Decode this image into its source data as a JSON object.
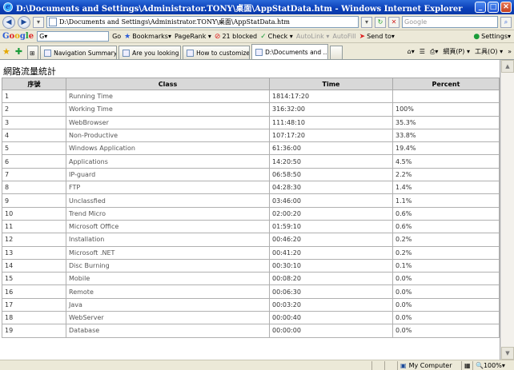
{
  "window": {
    "title": "D:\\Documents and Settings\\Administrator.TONY\\桌面\\AppStatData.htm - Windows Internet Explorer"
  },
  "addressbar": {
    "url": "D:\\Documents and Settings\\Administrator.TONY\\桌面\\AppStatData.htm",
    "search_placeholder": "Google"
  },
  "google_toolbar": {
    "logo": "Google",
    "search_value": "G▾",
    "go_label": "Go",
    "bookmarks_label": "Bookmarks▾",
    "pagerank_label": "PageRank ▾",
    "blocked_label": "21 blocked",
    "check_label": "Check ▾",
    "autolink_label": "AutoLink ▾",
    "autofill_label": "AutoFill",
    "sendto_label": "Send to▾",
    "settings_label": "Settings▾"
  },
  "tabs": [
    {
      "label": "Navigation Summary: ..."
    },
    {
      "label": "Are you looking for a ..."
    },
    {
      "label": "How to customize the ..."
    },
    {
      "label": "D:\\Documents and ..."
    }
  ],
  "tab_tools": {
    "page_label": "網頁(P) ▾",
    "tools_label": "工具(O) ▾"
  },
  "page": {
    "heading": "網路流量統計"
  },
  "table": {
    "headers": [
      "序號",
      "Class",
      "Time",
      "Percent"
    ],
    "rows": [
      [
        "1",
        "Running Time",
        "1814:17:20",
        ""
      ],
      [
        "2",
        "Working Time",
        "316:32:00",
        "100%"
      ],
      [
        "3",
        "WebBrowser",
        "111:48:10",
        "35.3%"
      ],
      [
        "4",
        "Non-Productive",
        "107:17:20",
        "33.8%"
      ],
      [
        "5",
        "Windows Application",
        "61:36:00",
        "19.4%"
      ],
      [
        "6",
        "Applications",
        "14:20:50",
        "4.5%"
      ],
      [
        "7",
        "IP-guard",
        "06:58:50",
        "2.2%"
      ],
      [
        "8",
        "FTP",
        "04:28:30",
        "1.4%"
      ],
      [
        "9",
        "Unclassfied",
        "03:46:00",
        "1.1%"
      ],
      [
        "10",
        "Trend Micro",
        "02:00:20",
        "0.6%"
      ],
      [
        "11",
        "Microsoft Office",
        "01:59:10",
        "0.6%"
      ],
      [
        "12",
        "Installation",
        "00:46:20",
        "0.2%"
      ],
      [
        "13",
        "Microsoft .NET",
        "00:41:20",
        "0.2%"
      ],
      [
        "14",
        "Disc Burning",
        "00:30:10",
        "0.1%"
      ],
      [
        "15",
        "Mobile",
        "00:08:20",
        "0.0%"
      ],
      [
        "16",
        "Remote",
        "00:06:30",
        "0.0%"
      ],
      [
        "17",
        "Java",
        "00:03:20",
        "0.0%"
      ],
      [
        "18",
        "WebServer",
        "00:00:40",
        "0.0%"
      ],
      [
        "19",
        "Database",
        "00:00:00",
        "0.0%"
      ]
    ]
  },
  "statusbar": {
    "zone": "My Computer",
    "zoom": "100%"
  }
}
